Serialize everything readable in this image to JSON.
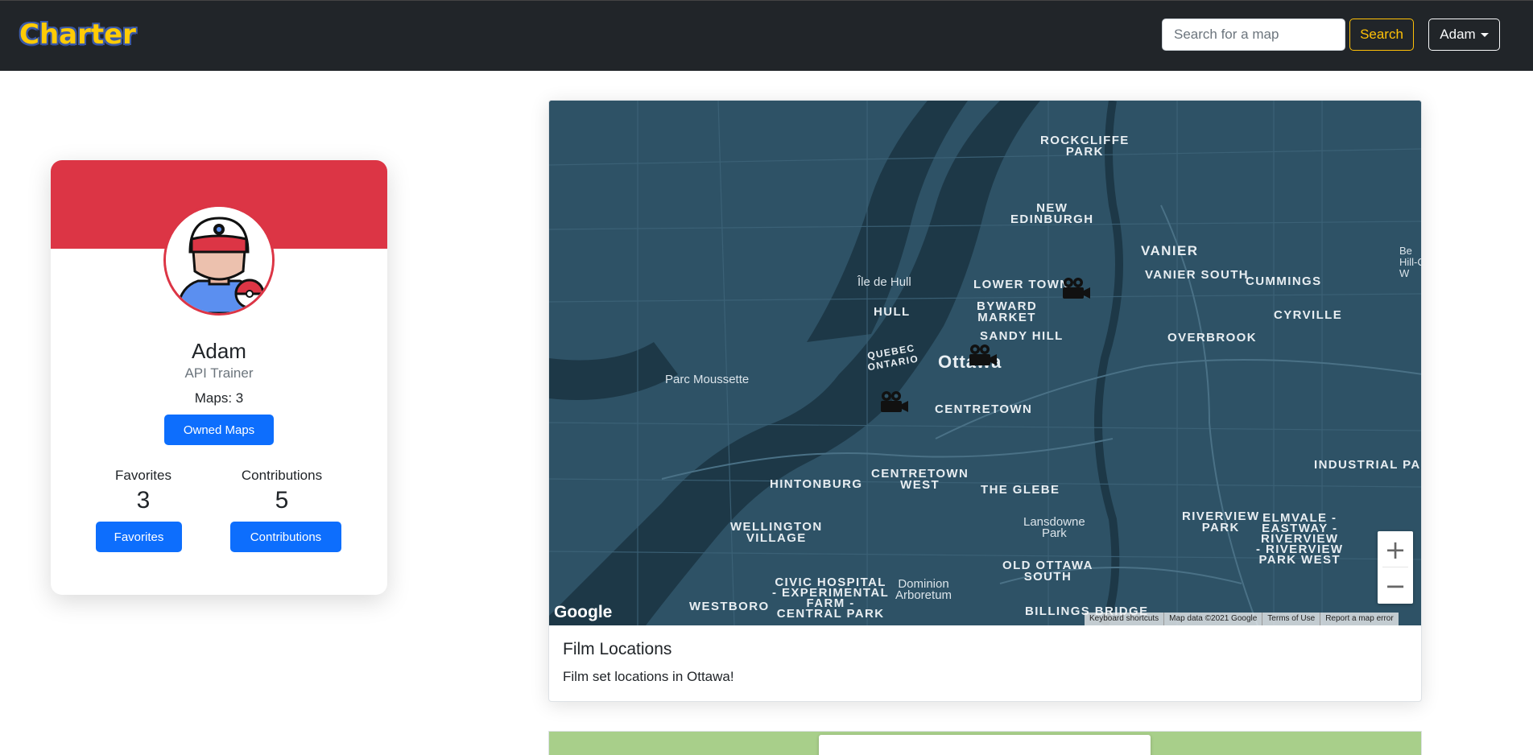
{
  "navbar": {
    "brand": "Charter",
    "search_placeholder": "Search for a map",
    "search_label": "Search",
    "user_label": "Adam"
  },
  "profile": {
    "name": "Adam",
    "role": "API Trainer",
    "maps_count": "Maps: 3",
    "owned_maps_label": "Owned Maps",
    "favorites_title": "Favorites",
    "favorites_count": "3",
    "favorites_label": "Favorites",
    "contributions_title": "Contributions",
    "contributions_count": "5",
    "contributions_label": "Contributions",
    "banner_color": "#dc3545"
  },
  "map": {
    "title": "Film Locations",
    "description": "Film set locations in Ottawa!",
    "labels": {
      "rockcliffe": "ROCKCLIFFE\nPARK",
      "new_edinburgh": "NEW\nEDINBURGH",
      "vanier": "VANIER",
      "vanier_south": "VANIER SOUTH",
      "cummings": "CUMMINGS",
      "cyrville": "CYRVILLE",
      "overbrook": "OVERBROOK",
      "lower_town": "LOWER TOWN",
      "byward": "BYWARD\nMARKET",
      "sandy_hill": "SANDY HILL",
      "ottawa": "Ottawa",
      "centretown": "CENTRETOWN",
      "centretown_west": "CENTRETOWN\nWEST",
      "glebe": "THE GLEBE",
      "hintonburg": "HINTONBURG",
      "wellington": "WELLINGTON\nVILLAGE",
      "civic": "CIVIC HOSPITAL\n- EXPERIMENTAL\nFARM -\nCENTRAL PARK",
      "westboro": "WESTBORO",
      "dominion": "Dominion\nArboretum",
      "old_ottawa_south": "OLD OTTAWA\nSOUTH",
      "lansdowne": "Lansdowne\nPark",
      "riverview_park": "RIVERVIEW\nPARK",
      "elmvale": "ELMVALE -\nEASTWAY -\nRIVERVIEW\n- RIVERVIEW\nPARK WEST",
      "industrial": "INDUSTRIAL PARK",
      "billings": "BILLINGS BRIDGE",
      "hull": "HULL",
      "ile_de_hull": "Île de Hull",
      "parc_moussette": "Parc Moussette",
      "quebec_ontario": "QUEBEC\nONTARIO",
      "beacon": "Be\nHill-C\nW",
      "quebec_top": "QUEBEC\nONTARIO"
    },
    "markers": [
      "camera-marker",
      "camera-marker",
      "camera-marker"
    ],
    "zoom_in": "+",
    "zoom_out": "−",
    "google": "Google",
    "attribution": [
      "Keyboard shortcuts",
      "Map data ©2021 Google",
      "Terms of Use",
      "Report a map error"
    ]
  }
}
